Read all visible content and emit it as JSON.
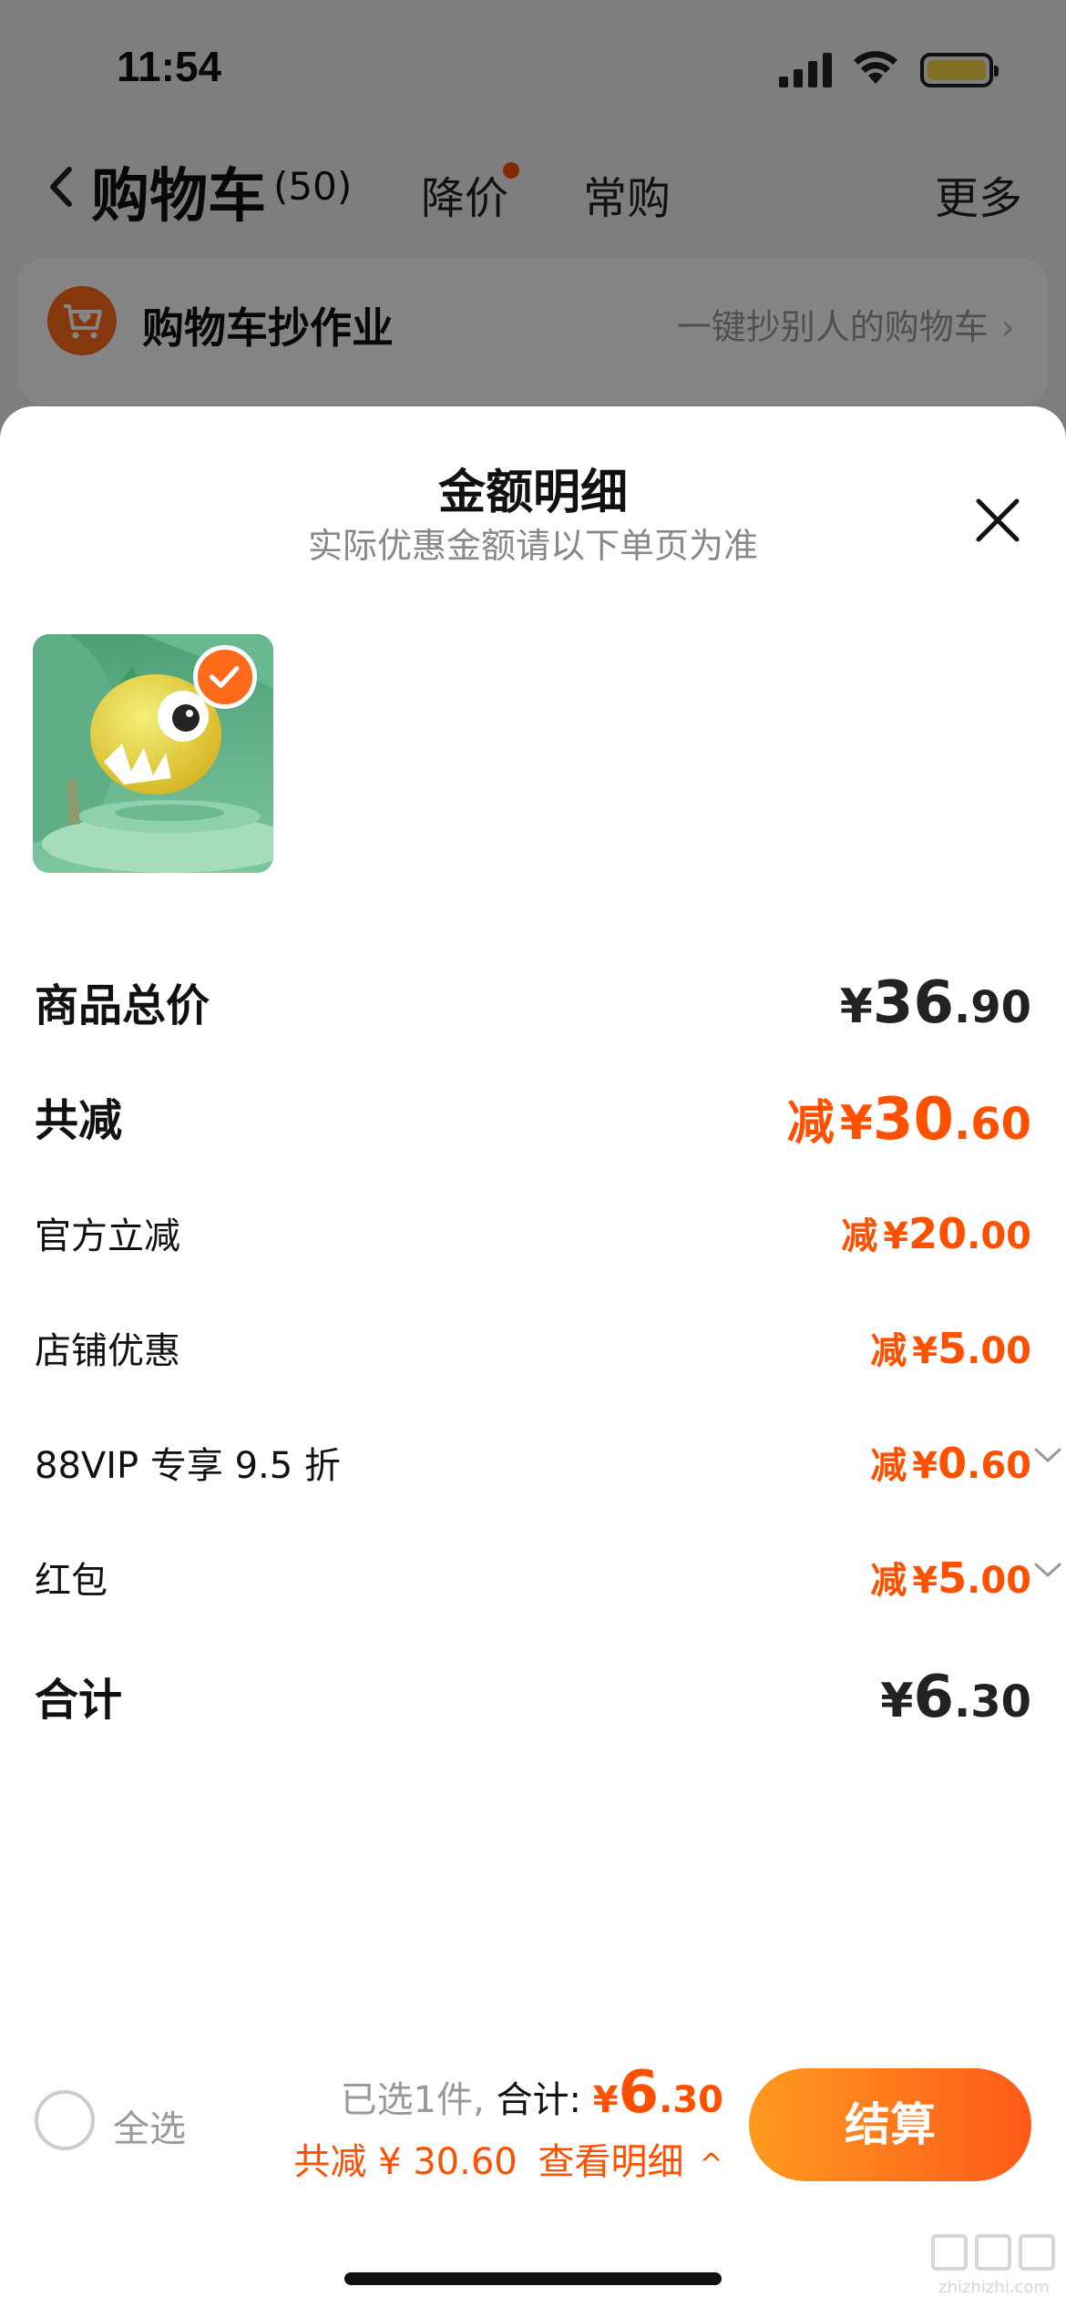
{
  "status_bar": {
    "time": "11:54"
  },
  "nav": {
    "title": "购物车",
    "count": "(50)",
    "tabs": [
      {
        "label": "降价",
        "has_dot": true
      },
      {
        "label": "常购"
      }
    ],
    "more": "更多"
  },
  "promo": {
    "title": "购物车抄作业",
    "link": "一键抄别人的购物车"
  },
  "sheet": {
    "title": "金额明细",
    "subtitle": "实际优惠金额请以下单页为准",
    "rows": {
      "subtotal": {
        "label": "商品总价",
        "yen": "¥",
        "int": "36",
        "dec": ".90"
      },
      "total_reduce": {
        "label": "共减",
        "prefix": "减",
        "yen": "¥",
        "int": "30",
        "dec": ".60"
      },
      "official": {
        "label": "官方立减",
        "prefix": "减",
        "yen": "¥",
        "int": "20",
        "dec": ".00"
      },
      "shop": {
        "label": "店铺优惠",
        "prefix": "减",
        "yen": "¥",
        "int": "5",
        "dec": ".00"
      },
      "vip": {
        "label": "88VIP 专享 9.5 折",
        "prefix": "减",
        "yen": "¥",
        "int": "0",
        "dec": ".60"
      },
      "redpacket": {
        "label": "红包",
        "prefix": "减",
        "yen": "¥",
        "int": "5",
        "dec": ".00"
      },
      "total": {
        "label": "合计",
        "yen": "¥",
        "int": "6",
        "dec": ".30"
      }
    }
  },
  "bottom": {
    "select_all": "全选",
    "selected_count": "已选1件,",
    "total_label": "合计:",
    "total_yen": "¥",
    "total_int": "6",
    "total_dec": ".30",
    "reduce_text": "共减 ¥ 30.60",
    "detail_link": "查看明细",
    "checkout": "结算"
  },
  "watermark": "zhizhizhi.com",
  "colors": {
    "accent": "#ff5000",
    "checkout_start": "#ff9a1f",
    "checkout_end": "#ff5a1a"
  }
}
